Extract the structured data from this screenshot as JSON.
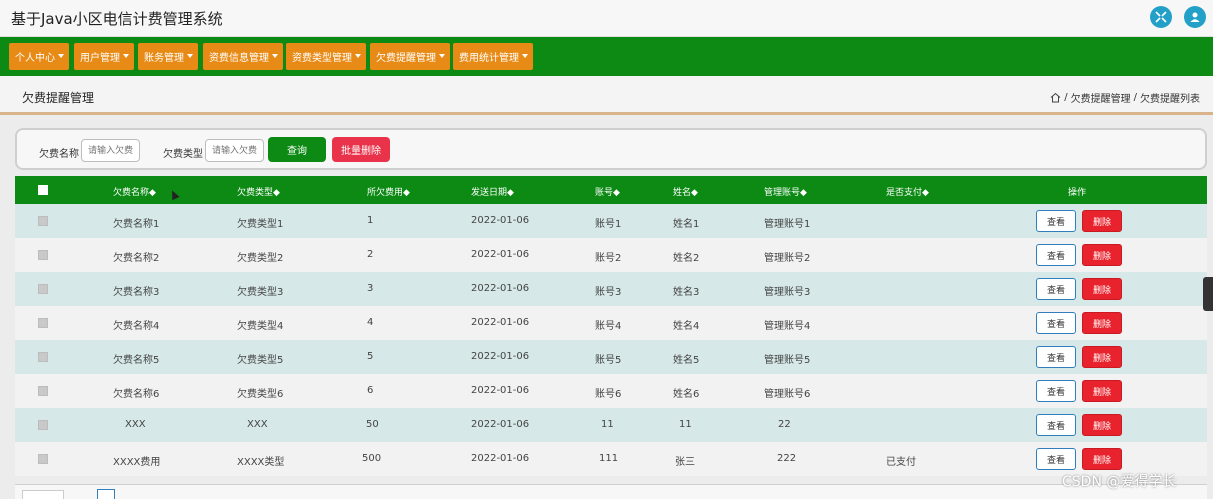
{
  "app": {
    "title": "基于Java小区电信计费管理系统"
  },
  "nav": {
    "items": [
      {
        "label": "个人中心"
      },
      {
        "label": "用户管理"
      },
      {
        "label": "账务管理"
      },
      {
        "label": "资费信息管理"
      },
      {
        "label": "资费类型管理"
      },
      {
        "label": "欠费提醒管理"
      },
      {
        "label": "费用统计管理"
      }
    ]
  },
  "page": {
    "title": "欠费提醒管理",
    "breadcrumb": {
      "sep": "/",
      "level1": "欠费提醒管理",
      "level2": "欠费提醒列表"
    }
  },
  "search": {
    "name_label": "欠费名称",
    "name_placeholder": "请输入欠费",
    "type_label": "欠费类型",
    "type_placeholder": "请输入欠费",
    "query_label": "查询",
    "batch_delete_label": "批量删除"
  },
  "table": {
    "columns": [
      "欠费名称◆",
      "欠费类型◆",
      "所欠费用◆",
      "发送日期◆",
      "账号◆",
      "姓名◆",
      "管理账号◆",
      "是否支付◆",
      "操作"
    ],
    "view_label": "查看",
    "delete_label": "删除",
    "rows": [
      {
        "name": "欠费名称1",
        "type": "欠费类型1",
        "fee": "1",
        "date": "2022-01-06",
        "account": "账号1",
        "xm": "姓名1",
        "manager": "管理账号1",
        "paid": ""
      },
      {
        "name": "欠费名称2",
        "type": "欠费类型2",
        "fee": "2",
        "date": "2022-01-06",
        "account": "账号2",
        "xm": "姓名2",
        "manager": "管理账号2",
        "paid": ""
      },
      {
        "name": "欠费名称3",
        "type": "欠费类型3",
        "fee": "3",
        "date": "2022-01-06",
        "account": "账号3",
        "xm": "姓名3",
        "manager": "管理账号3",
        "paid": ""
      },
      {
        "name": "欠费名称4",
        "type": "欠费类型4",
        "fee": "4",
        "date": "2022-01-06",
        "account": "账号4",
        "xm": "姓名4",
        "manager": "管理账号4",
        "paid": ""
      },
      {
        "name": "欠费名称5",
        "type": "欠费类型5",
        "fee": "5",
        "date": "2022-01-06",
        "account": "账号5",
        "xm": "姓名5",
        "manager": "管理账号5",
        "paid": ""
      },
      {
        "name": "欠费名称6",
        "type": "欠费类型6",
        "fee": "6",
        "date": "2022-01-06",
        "account": "账号6",
        "xm": "姓名6",
        "manager": "管理账号6",
        "paid": ""
      },
      {
        "name": "XXX",
        "type": "XXX",
        "fee": "50",
        "date": "2022-01-06",
        "account": "11",
        "xm": "11",
        "manager": "22",
        "paid": ""
      },
      {
        "name": "XXXX费用",
        "type": "XXXX类型",
        "fee": "500",
        "date": "2022-01-06",
        "account": "111",
        "xm": "张三",
        "manager": "222",
        "paid": "已支付"
      }
    ]
  },
  "watermark": "CSDN @爱得学长",
  "colors": {
    "primary": "#0c8a14",
    "accent": "#e88b16",
    "danger": "#e8232d",
    "row_alt": "#d6e8e8"
  }
}
